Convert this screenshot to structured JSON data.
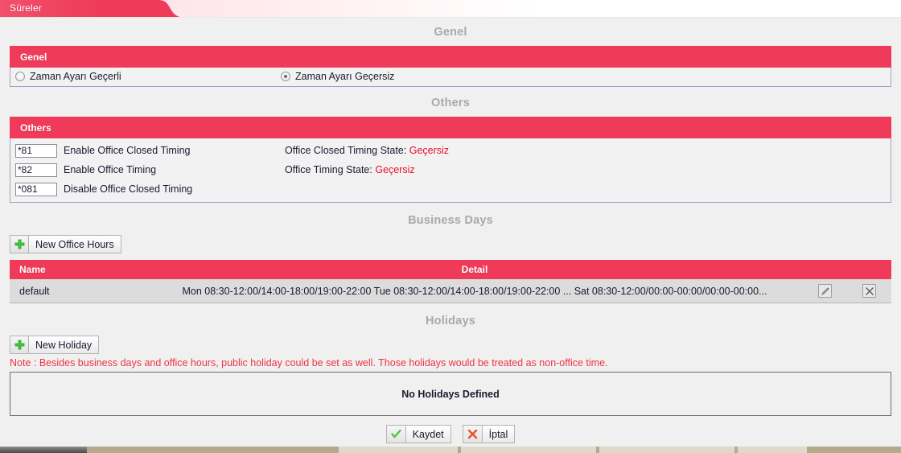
{
  "tab": {
    "label": "Süreler"
  },
  "sections": {
    "genel": {
      "title": "Genel",
      "panel_header": "Genel",
      "options": [
        {
          "label": "Zaman Ayarı Geçerli",
          "selected": false
        },
        {
          "label": "Zaman Ayarı Geçersiz",
          "selected": true
        }
      ]
    },
    "others": {
      "title": "Others",
      "panel_header": "Others",
      "rows": [
        {
          "code": "*81",
          "label": "Enable Office Closed Timing"
        },
        {
          "code": "*82",
          "label": "Enable Office Timing"
        },
        {
          "code": "*081",
          "label": "Disable Office Closed Timing"
        }
      ],
      "states": [
        {
          "label": "Office Closed Timing State:",
          "value": "Geçersiz"
        },
        {
          "label": "Office Timing State:",
          "value": "Geçersiz"
        }
      ]
    },
    "business_days": {
      "title": "Business Days",
      "new_button": "New Office Hours",
      "columns": [
        "Name",
        "Detail"
      ],
      "rows": [
        {
          "name": "default",
          "detail": "Mon 08:30-12:00/14:00-18:00/19:00-22:00  Tue 08:30-12:00/14:00-18:00/19:00-22:00 ... Sat 08:30-12:00/00:00-00:00/00:00-00:00...",
          "edit_icon": "pencil-icon",
          "delete_icon": "close-icon"
        }
      ]
    },
    "holidays": {
      "title": "Holidays",
      "new_button": "New Holiday",
      "note_prefix": "Note :",
      "note_text": "Besides business days and office hours, public holiday could be set as well. Those holidays would be treated as non-office time.",
      "empty_message": "No Holidays Defined"
    }
  },
  "footer": {
    "save_label": "Kaydet",
    "cancel_label": "İptal"
  },
  "colors": {
    "accent_red": "#ef3a5a",
    "note_red": "#ee3344",
    "state_red": "#e8102a",
    "section_title_gray": "#a9a9a9",
    "page_background": "#f0f0f0"
  },
  "icons": {
    "plus": "plus-icon",
    "check": "check-icon",
    "cross": "cross-icon"
  }
}
